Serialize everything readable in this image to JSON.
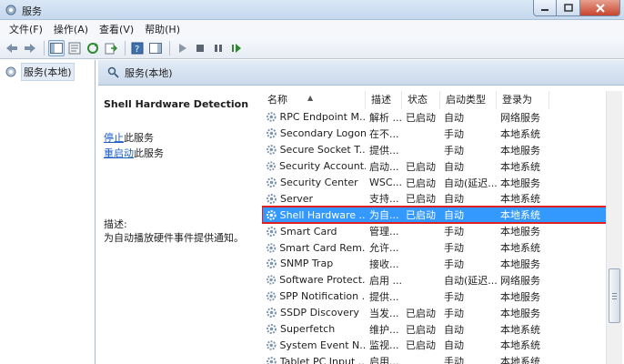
{
  "window": {
    "title": "服务"
  },
  "menu": [
    {
      "label": "文件(F)"
    },
    {
      "label": "操作(A)"
    },
    {
      "label": "查看(V)"
    },
    {
      "label": "帮助(H)"
    }
  ],
  "tree": {
    "root_label": "服务(本地)"
  },
  "panel": {
    "header": "服务(本地)"
  },
  "detail": {
    "title": "Shell Hardware Detection",
    "stop_link": "停止",
    "stop_suffix": "此服务",
    "restart_link": "重启动",
    "restart_suffix": "此服务",
    "desc_label": "描述:",
    "desc_text": "为自动播放硬件事件提供通知。"
  },
  "table": {
    "columns": [
      "名称",
      "描述",
      "状态",
      "启动类型",
      "登录为"
    ],
    "rows": [
      {
        "name": "RPC Endpoint M...",
        "desc": "解析 ...",
        "status": "已启动",
        "startup": "自动",
        "logon": "网络服务"
      },
      {
        "name": "Secondary Logon",
        "desc": "在不...",
        "status": "",
        "startup": "手动",
        "logon": "本地系统"
      },
      {
        "name": "Secure Socket T...",
        "desc": "提供...",
        "status": "",
        "startup": "手动",
        "logon": "本地服务"
      },
      {
        "name": "Security Account...",
        "desc": "启动...",
        "status": "已启动",
        "startup": "自动",
        "logon": "本地系统"
      },
      {
        "name": "Security Center",
        "desc": "WSC...",
        "status": "已启动",
        "startup": "自动(延迟...",
        "logon": "本地服务"
      },
      {
        "name": "Server",
        "desc": "支持...",
        "status": "已启动",
        "startup": "自动",
        "logon": "本地系统"
      },
      {
        "name": "Shell Hardware ...",
        "desc": "为自...",
        "status": "已启动",
        "startup": "自动",
        "logon": "本地系统",
        "selected": true
      },
      {
        "name": "Smart Card",
        "desc": "管理...",
        "status": "",
        "startup": "手动",
        "logon": "本地服务"
      },
      {
        "name": "Smart Card Rem...",
        "desc": "允许...",
        "status": "",
        "startup": "手动",
        "logon": "本地系统"
      },
      {
        "name": "SNMP Trap",
        "desc": "接收...",
        "status": "",
        "startup": "手动",
        "logon": "本地服务"
      },
      {
        "name": "Software Protect...",
        "desc": "启用 ...",
        "status": "",
        "startup": "自动(延迟...",
        "logon": "网络服务"
      },
      {
        "name": "SPP Notification ...",
        "desc": "提供...",
        "status": "",
        "startup": "手动",
        "logon": "本地服务"
      },
      {
        "name": "SSDP Discovery",
        "desc": "当发...",
        "status": "已启动",
        "startup": "手动",
        "logon": "本地服务"
      },
      {
        "name": "Superfetch",
        "desc": "维护...",
        "status": "已启动",
        "startup": "自动",
        "logon": "本地系统"
      },
      {
        "name": "System Event N...",
        "desc": "监视...",
        "status": "已启动",
        "startup": "自动",
        "logon": "本地系统"
      },
      {
        "name": "Tablet PC Input ...",
        "desc": "启用...",
        "status": "",
        "startup": "手动",
        "logon": "本地系统"
      }
    ]
  },
  "colors": {
    "selection": "#3399ff",
    "highlight_border": "#e02020",
    "link": "#1a5ec4"
  }
}
